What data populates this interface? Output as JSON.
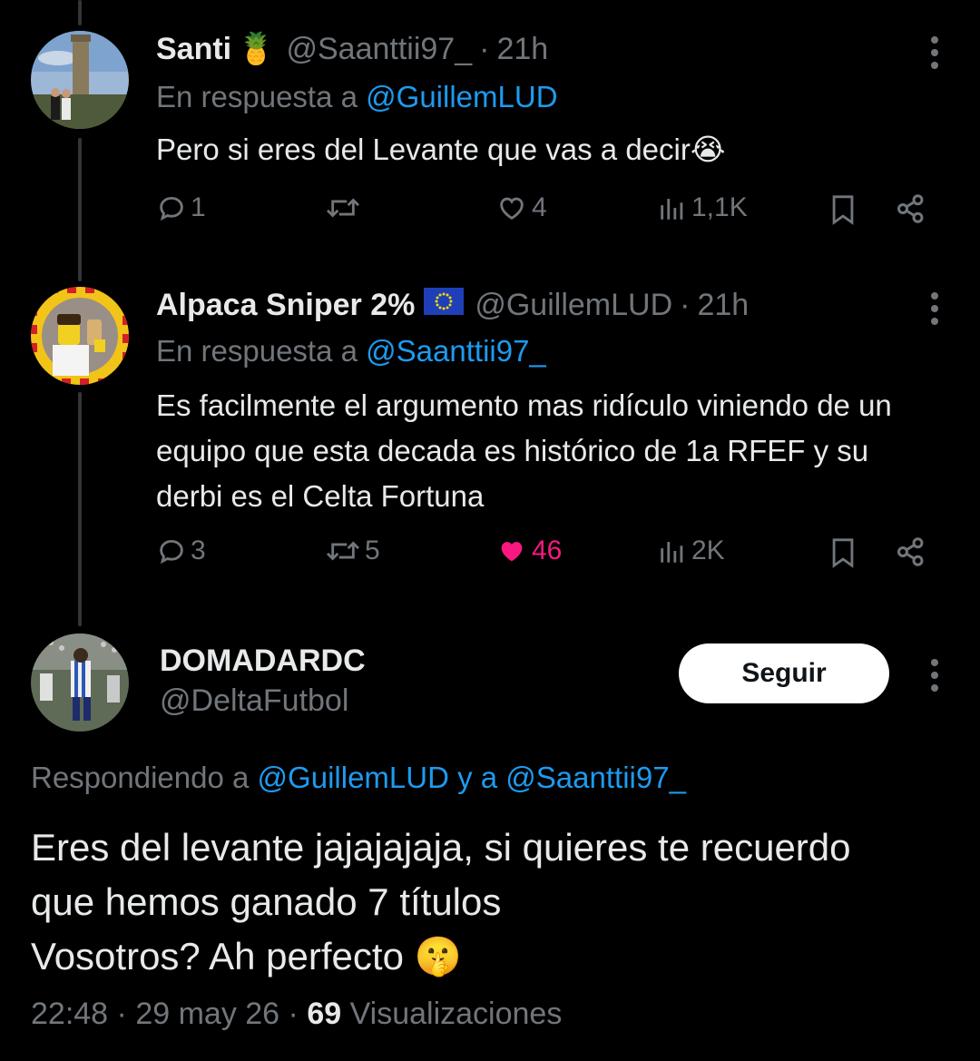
{
  "replies": [
    {
      "name": "Santi",
      "name_emoji": "🍍",
      "handle": "@Saanttii97_",
      "separator": "·",
      "time": "21h",
      "reply_prefix": "En respuesta a",
      "reply_to": "@GuillemLUD",
      "text": "Pero si eres del Levante que vas a decir😭",
      "stats": {
        "replies": "1",
        "retweets": "",
        "likes": "4",
        "views": "1,1K"
      },
      "liked": false
    },
    {
      "name": "Alpaca Sniper 2%",
      "name_emoji": "🇪🇺",
      "handle": "@GuillemLUD",
      "separator": "·",
      "time": "21h",
      "reply_prefix": "En respuesta a",
      "reply_to": "@Saanttii97_",
      "text": "Es facilmente el argumento mas ridículo viniendo de un equipo que esta decada es histórico de 1a RFEF y su derbi es el Celta Fortuna",
      "stats": {
        "replies": "3",
        "retweets": "5",
        "likes": "46",
        "views": "2K"
      },
      "liked": true
    }
  ],
  "main": {
    "name": "DOMADARDC",
    "handle": "@DeltaFutbol",
    "follow_label": "Seguir",
    "replying_prefix": "Respondiendo a",
    "replying_user1": "@GuillemLUD",
    "replying_joiner": "y a",
    "replying_user2": "@Saanttii97_",
    "text_line1": "Eres del levante jajajajaja, si quieres te recuerdo",
    "text_line2": "que hemos ganado 7 títulos",
    "text_line3": "Vosotros? Ah perfecto 🤫",
    "time": "22:48",
    "separator": "·",
    "date": "29 may 26",
    "views_count": "69",
    "views_label": "Visualizaciones"
  },
  "colors": {
    "background": "#000000",
    "text": "#e7e9ea",
    "muted": "#71767b",
    "link": "#1d9bf0",
    "like_active": "#f91880"
  },
  "icons": [
    "more-icon",
    "reply-icon",
    "retweet-icon",
    "like-icon",
    "views-icon",
    "bookmark-icon",
    "share-icon"
  ]
}
